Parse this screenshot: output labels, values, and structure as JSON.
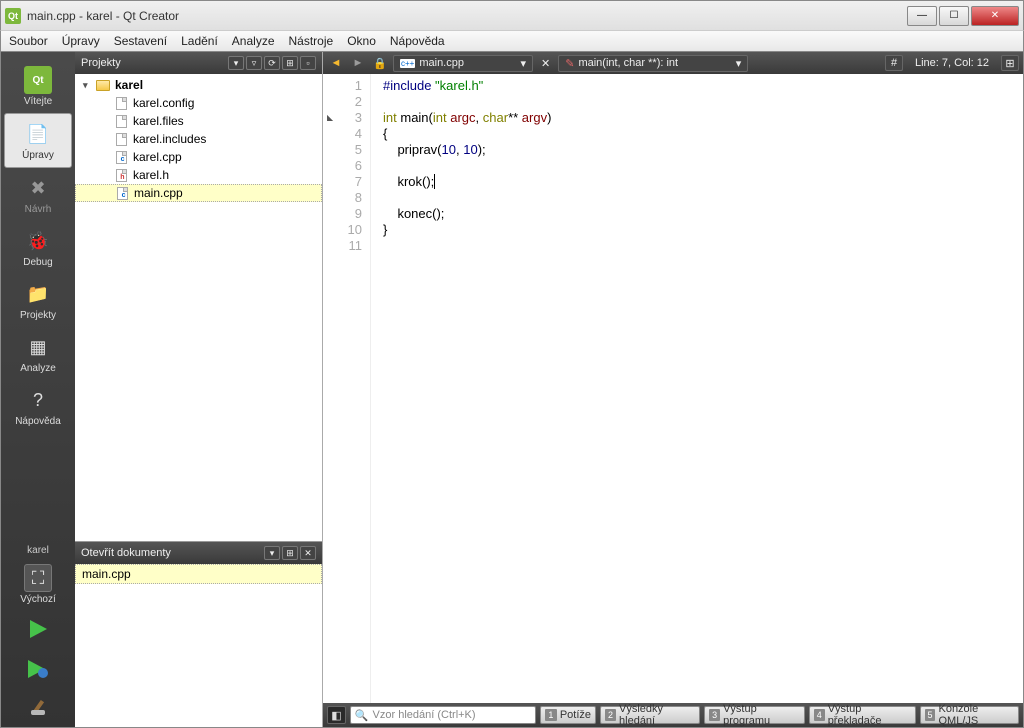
{
  "window": {
    "title": "main.cpp - karel - Qt Creator"
  },
  "menu": [
    "Soubor",
    "Úpravy",
    "Sestavení",
    "Ladění",
    "Analyze",
    "Nástroje",
    "Okno",
    "Nápověda"
  ],
  "modes": [
    {
      "label": "Vítejte",
      "icon": "Qt",
      "color": "#7db83c"
    },
    {
      "label": "Úpravy",
      "icon": "📄",
      "active": true
    },
    {
      "label": "Návrh",
      "icon": "✖",
      "disabled": true
    },
    {
      "label": "Debug",
      "icon": "🐞"
    },
    {
      "label": "Projekty",
      "icon": "📁"
    },
    {
      "label": "Analyze",
      "icon": "▦"
    },
    {
      "label": "Nápověda",
      "icon": "?"
    }
  ],
  "kit": {
    "project": "karel",
    "config": "Výchozí"
  },
  "projects_panel": {
    "title": "Projekty",
    "root": "karel",
    "files": [
      {
        "name": "karel.config",
        "type": "file"
      },
      {
        "name": "karel.files",
        "type": "file"
      },
      {
        "name": "karel.includes",
        "type": "file"
      },
      {
        "name": "karel.cpp",
        "type": "cpp"
      },
      {
        "name": "karel.h",
        "type": "h"
      },
      {
        "name": "main.cpp",
        "type": "cpp",
        "selected": true
      }
    ]
  },
  "open_docs": {
    "title": "Otevřít dokumenty",
    "items": [
      "main.cpp"
    ]
  },
  "editor": {
    "tab": "main.cpp",
    "func": "main(int, char **): int",
    "status": "Line: 7, Col: 12",
    "lines": [
      {
        "n": 1,
        "tokens": [
          [
            "pp",
            "#include "
          ],
          [
            "str",
            "\"karel.h\""
          ]
        ]
      },
      {
        "n": 2,
        "tokens": []
      },
      {
        "n": 3,
        "mark": true,
        "tokens": [
          [
            "kw",
            "int"
          ],
          [
            "",
            " "
          ],
          [
            "",
            "main("
          ],
          [
            "kw",
            "int"
          ],
          [
            "",
            " "
          ],
          [
            "id",
            "argc"
          ],
          [
            "",
            ", "
          ],
          [
            "kw",
            "char"
          ],
          [
            "",
            "** "
          ],
          [
            "id",
            "argv"
          ],
          [
            "",
            ")"
          ]
        ]
      },
      {
        "n": 4,
        "tokens": [
          [
            "",
            "{"
          ]
        ]
      },
      {
        "n": 5,
        "tokens": [
          [
            "",
            "    priprav("
          ],
          [
            "num",
            "10"
          ],
          [
            "",
            ", "
          ],
          [
            "num",
            "10"
          ],
          [
            "",
            ");"
          ]
        ]
      },
      {
        "n": 6,
        "tokens": []
      },
      {
        "n": 7,
        "tokens": [
          [
            "",
            "    krok();"
          ]
        ],
        "cursor": true
      },
      {
        "n": 8,
        "tokens": []
      },
      {
        "n": 9,
        "tokens": [
          [
            "",
            "    konec();"
          ]
        ]
      },
      {
        "n": 10,
        "tokens": [
          [
            "",
            "}"
          ]
        ]
      },
      {
        "n": 11,
        "tokens": []
      }
    ]
  },
  "search_placeholder": "Vzor hledání (Ctrl+K)",
  "output_tabs": [
    {
      "n": "1",
      "label": "Potíže"
    },
    {
      "n": "2",
      "label": "Výsledky hledání"
    },
    {
      "n": "3",
      "label": "Výstup programu"
    },
    {
      "n": "4",
      "label": "Výstup překladače"
    },
    {
      "n": "5",
      "label": "Konzole QML/JS"
    }
  ]
}
